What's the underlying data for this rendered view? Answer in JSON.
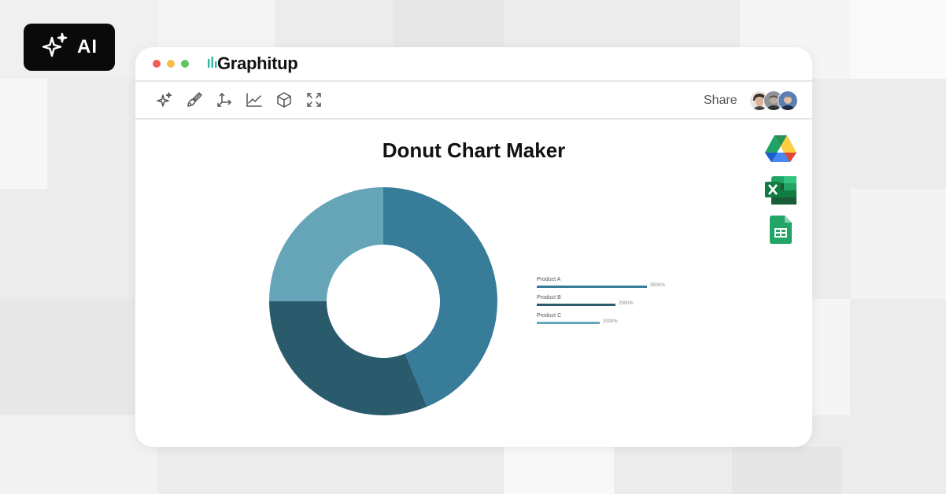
{
  "badge": {
    "label": "AI",
    "icon": "sparkles-icon"
  },
  "window": {
    "traffic_lights": [
      "#ed5f57",
      "#f5bd4f",
      "#5ec45b"
    ],
    "logo_text": "Graphitup",
    "brand_color": "#2bb8a4"
  },
  "toolbar": {
    "tools": [
      "sparkles-icon",
      "paintbrush-icon",
      "axes-icon",
      "line-chart-icon",
      "cube-icon",
      "fullscreen-icon"
    ],
    "share_label": "Share"
  },
  "integrations": [
    "google-drive-icon",
    "excel-icon",
    "google-sheets-icon"
  ],
  "chart_data": {
    "type": "pie",
    "title": "Donut Chart Maker",
    "donut": true,
    "categories": [
      "Product A",
      "Product B",
      "Product C"
    ],
    "values": [
      3500,
      2500,
      2000
    ],
    "value_labels": [
      "3500%",
      "2500%",
      "2000%"
    ],
    "colors": [
      "#377c98",
      "#2a5b6d",
      "#66a5b7"
    ]
  }
}
